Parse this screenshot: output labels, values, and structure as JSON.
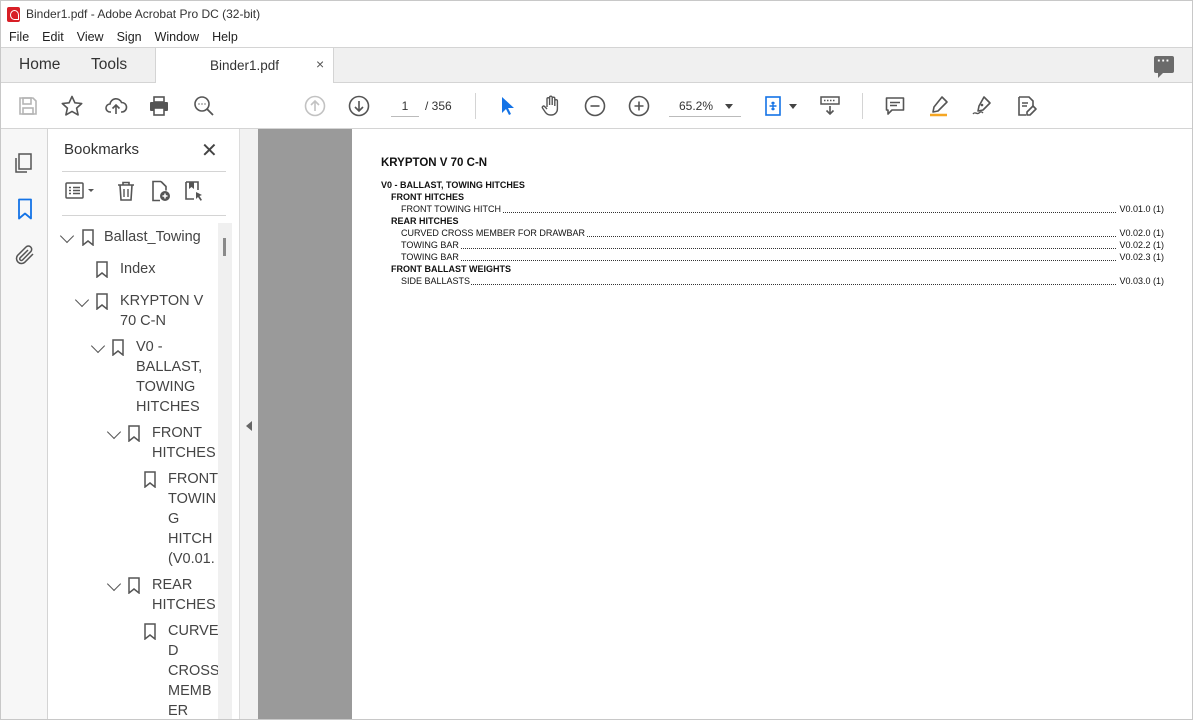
{
  "window": {
    "title": "Binder1.pdf - Adobe Acrobat Pro DC (32-bit)"
  },
  "menu": [
    "File",
    "Edit",
    "View",
    "Sign",
    "Window",
    "Help"
  ],
  "tabs": {
    "home": "Home",
    "tools": "Tools",
    "document": "Binder1.pdf",
    "close": "×"
  },
  "toolbar": {
    "current_page": "1",
    "page_total": "/ 356",
    "zoom": "65.2%"
  },
  "bookmarks": {
    "title": "Bookmarks",
    "close": "✕",
    "items": [
      {
        "label": "Ballast_Towing"
      },
      {
        "label": "Index"
      },
      {
        "label": "KRYPTON V\n70 C-N"
      },
      {
        "label": "V0 -\nBALLAST,\nTOWING\nHITCHES"
      },
      {
        "label": "FRONT\nHITCHES"
      },
      {
        "label": "FRONT\nTOWIN\nG\nHITCH\n(V0.01."
      },
      {
        "label": "REAR\nHITCHES"
      },
      {
        "label": "CURVE\nD\nCROSS\nMEMB\nER"
      }
    ]
  },
  "document": {
    "title": "KRYPTON V 70 C-N",
    "toc": [
      {
        "text": "V0 - BALLAST, TOWING HITCHES",
        "ref": "",
        "bold": true,
        "indent": 0
      },
      {
        "text": "FRONT HITCHES",
        "ref": "",
        "bold": true,
        "indent": 1
      },
      {
        "text": "FRONT TOWING HITCH",
        "ref": "V0.01.0 (1)",
        "bold": false,
        "indent": 2
      },
      {
        "text": "REAR HITCHES",
        "ref": "",
        "bold": true,
        "indent": 1
      },
      {
        "text": "CURVED CROSS MEMBER FOR DRAWBAR",
        "ref": "V0.02.0 (1)",
        "bold": false,
        "indent": 2
      },
      {
        "text": "TOWING BAR",
        "ref": "V0.02.2 (1)",
        "bold": false,
        "indent": 2
      },
      {
        "text": "TOWING BAR",
        "ref": "V0.02.3 (1)",
        "bold": false,
        "indent": 2
      },
      {
        "text": "FRONT BALLAST WEIGHTS",
        "ref": "",
        "bold": true,
        "indent": 1
      },
      {
        "text": "SIDE BALLASTS",
        "ref": "V0.03.0 (1)",
        "bold": false,
        "indent": 2
      }
    ]
  },
  "colors": {
    "accent": "#1473e6",
    "pdf_red": "#d81f26",
    "doc_gray": "#9a9a9a"
  }
}
